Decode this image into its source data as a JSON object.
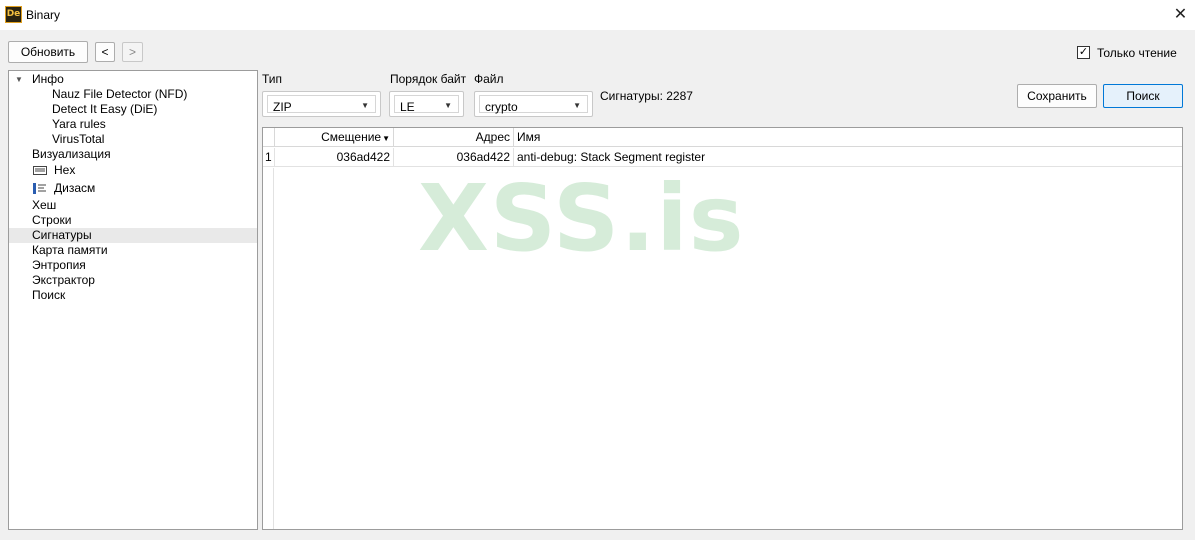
{
  "window": {
    "title": "Binary",
    "app_icon_text": "De",
    "close_glyph": "✕"
  },
  "toolbar": {
    "refresh_label": "Обновить",
    "prev_label": "<",
    "next_label": ">",
    "readonly_label": "Только чтение",
    "readonly_checked": true,
    "check_glyph": "✓"
  },
  "tree": {
    "expander_glyph": "▼",
    "items": [
      {
        "label": "Инфо"
      },
      {
        "label": "Nauz File Detector (NFD)"
      },
      {
        "label": "Detect It Easy (DiE)"
      },
      {
        "label": "Yara rules"
      },
      {
        "label": "VirusTotal"
      },
      {
        "label": "Визуализация"
      },
      {
        "label": "Hex",
        "icon": "hex-icon"
      },
      {
        "label": "Дизасм",
        "icon": "disasm-icon"
      },
      {
        "label": "Хеш"
      },
      {
        "label": "Строки"
      },
      {
        "label": "Сигнатуры",
        "selected": true
      },
      {
        "label": "Карта памяти"
      },
      {
        "label": "Энтропия"
      },
      {
        "label": "Экстрактор"
      },
      {
        "label": "Поиск"
      }
    ]
  },
  "filters": {
    "type_label": "Тип",
    "type_value": "ZIP",
    "byteorder_label": "Порядок байт",
    "byteorder_value": "LE",
    "file_label": "Файл",
    "file_value": "crypto",
    "dropdown_glyph": "▼",
    "signatures_count": "Сигнатуры: 2287"
  },
  "actions": {
    "save_label": "Сохранить",
    "search_label": "Поиск"
  },
  "table": {
    "headers": {
      "offset": "Смещение",
      "address": "Адрес",
      "name": "Имя"
    },
    "sort_glyph": "▼",
    "rows": [
      {
        "index": "1",
        "offset": "036ad422",
        "address": "036ad422",
        "name": "anti-debug: Stack Segment register"
      }
    ]
  },
  "watermark": "XSS.is",
  "colors": {
    "accent": "#0078d7",
    "watermark": "#d6ecd9",
    "selection": "#e9e9e9"
  }
}
